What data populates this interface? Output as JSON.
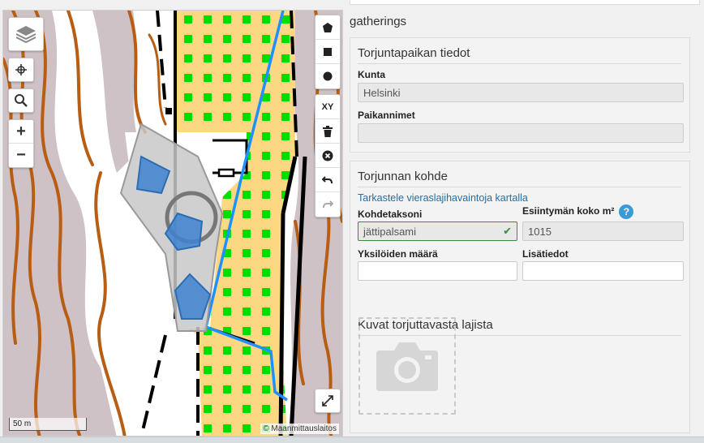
{
  "map": {
    "scale_label": "50 m",
    "attribution": "© Maanmittauslaitos",
    "controls": {
      "layers_icon": "layers-icon",
      "locate_icon": "crosshair-icon",
      "search_icon": "search-icon",
      "zoom_in": "+",
      "zoom_out": "−"
    },
    "draw_tools": {
      "polygon_icon": "polygon-icon",
      "rectangle_icon": "square-icon",
      "circle_icon": "circle-icon",
      "coordinates_label": "XY",
      "delete_icon": "trash-icon",
      "cancel_icon": "cancel-icon",
      "undo_icon": "undo-icon",
      "redo_icon": "redo-icon"
    },
    "fullscreen_icon": "expand-icon"
  },
  "panel": {
    "heading": "gatherings",
    "location": {
      "title": "Torjuntapaikan tiedot",
      "municipality_label": "Kunta",
      "municipality_value": "Helsinki",
      "place_names_label": "Paikannimet",
      "place_names_value": ""
    },
    "target": {
      "title": "Torjunnan kohde",
      "view_link": "Tarkastele vieraslajihavaintoja kartalla",
      "taxon_label": "Kohdetaksoni",
      "taxon_value": "jättipalsami",
      "size_label": "Esiintymän koko m²",
      "size_help": "?",
      "size_value": "1015",
      "count_label": "Yksilöiden määrä",
      "count_value": "",
      "notes_label": "Lisätiedot",
      "notes_value": "",
      "photos_title": "Kuvat torjuttavasta lajista"
    }
  },
  "colors": {
    "accent_link": "#1f6fa8",
    "valid_green": "#3a8a3a",
    "help_blue": "#3b9bd6",
    "map_field": "#fcd882",
    "map_dots": "#00e000",
    "map_contour": "#b85e14",
    "map_water": "#1e90ff",
    "polygon_fill": "#3f82d0"
  }
}
